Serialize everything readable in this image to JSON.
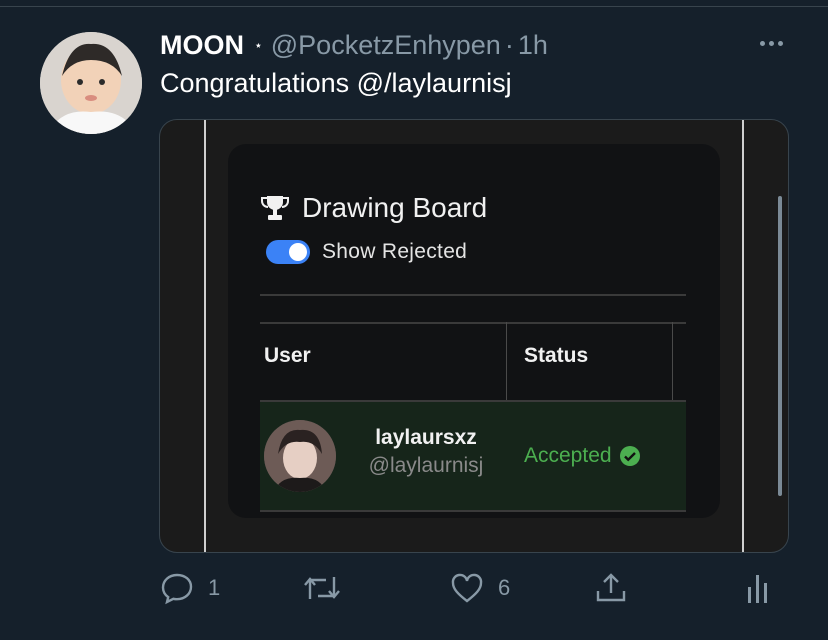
{
  "tweet": {
    "author_name": "MOON",
    "badge": "⋆",
    "handle": "@PocketzEnhypen",
    "separator": "·",
    "time": "1h",
    "text": "Congratulations @/laylaurnisj"
  },
  "embedded_card": {
    "title": "Drawing Board",
    "toggle_label": "Show Rejected",
    "toggle_on": true,
    "columns": [
      "User",
      "Status"
    ],
    "rows": [
      {
        "display_name": "laylaursxz",
        "username": "@laylaurnisj",
        "status": "Accepted"
      }
    ]
  },
  "actions": {
    "replies": "1",
    "likes": "6"
  },
  "colors": {
    "background": "#15202b",
    "secondary_text": "#8899a6",
    "toggle": "#3b82f6",
    "accepted": "#4caf50"
  }
}
